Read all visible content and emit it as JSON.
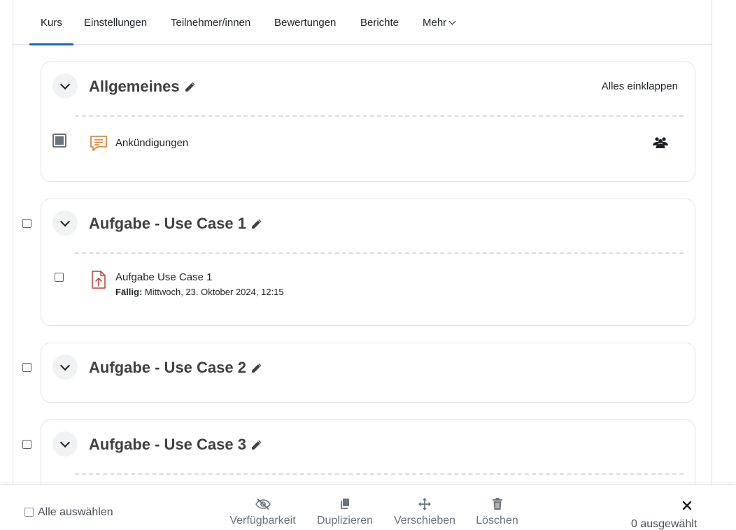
{
  "tabs": [
    {
      "label": "Kurs",
      "active": true
    },
    {
      "label": "Einstellungen"
    },
    {
      "label": "Teilnehmer/innen"
    },
    {
      "label": "Bewertungen"
    },
    {
      "label": "Berichte"
    },
    {
      "label": "Mehr"
    }
  ],
  "sections": [
    {
      "title": "Allgemeines",
      "collapse_all_label": "Alles einklappen",
      "activities": [
        {
          "name": "Ankündigungen",
          "icon": "forum-icon",
          "group_icon": "groups-icon"
        }
      ]
    },
    {
      "title": "Aufgabe - Use Case 1",
      "activities": [
        {
          "name": "Aufgabe Use Case 1",
          "icon": "assignment-icon",
          "due_label": "Fällig:",
          "due_date": "Mittwoch, 23. Oktober 2024, 12:15"
        }
      ]
    },
    {
      "title": "Aufgabe - Use Case 2",
      "activities": []
    },
    {
      "title": "Aufgabe - Use Case 3",
      "activities": []
    }
  ],
  "bulk": {
    "select_all_label": "Alle auswählen",
    "actions": [
      {
        "label": "Verfügbarkeit",
        "icon": "eye-slash-icon"
      },
      {
        "label": "Duplizieren",
        "icon": "copy-icon"
      },
      {
        "label": "Verschieben",
        "icon": "move-icon"
      },
      {
        "label": "Löschen",
        "icon": "trash-icon"
      }
    ],
    "selected_count": "0 ausgewählt"
  },
  "colors": {
    "accent": "#0f6cbf",
    "forum_icon": "#d4792a",
    "assign_icon": "#c23b2e",
    "text": "#1d2125"
  }
}
